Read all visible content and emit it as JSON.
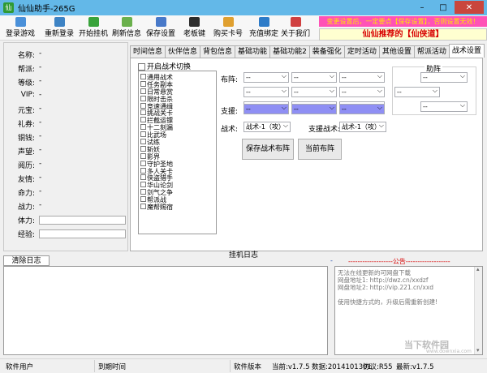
{
  "window": {
    "title": "仙仙助手-265G",
    "minimize": "–",
    "maximize": "□",
    "close": "✕"
  },
  "toolbar": {
    "login": "登录游戏",
    "relogin": "重新登录",
    "start": "开始挂机",
    "refresh": "刷新信息",
    "save": "保存设置",
    "boss": "老板键",
    "buycard": "购买卡号",
    "bind": "充值绑定",
    "about": "关于我们"
  },
  "notice": {
    "warning": "变更设置后，一定要点【保存设置】，否则设置无效！",
    "recommend": "仙仙推荐的【仙侠道】"
  },
  "stats": [
    {
      "label": "名称:",
      "value": "-"
    },
    {
      "label": "帮派:",
      "value": "-"
    },
    {
      "label": "等级:",
      "value": "-"
    },
    {
      "label": "VIP:",
      "value": "-"
    },
    {
      "label": "元宝:",
      "value": "-"
    },
    {
      "label": "礼券:",
      "value": "-"
    },
    {
      "label": "铜钱:",
      "value": "-"
    },
    {
      "label": "声望:",
      "value": "-"
    },
    {
      "label": "阅历:",
      "value": "-"
    },
    {
      "label": "友情:",
      "value": "-"
    },
    {
      "label": "命力:",
      "value": "-"
    },
    {
      "label": "战力:",
      "value": "-"
    }
  ],
  "bars": {
    "stamina_label": "体力:",
    "exp_label": "经验:"
  },
  "tabs": [
    "时间信息",
    "伙伴信息",
    "背包信息",
    "基础功能",
    "基础功能2",
    "装备强化",
    "定时活动",
    "其他设置",
    "帮派活动",
    "战术设置"
  ],
  "tactics": {
    "switch_label": "开启战术切换",
    "skills": [
      "通用战术",
      "任务副本",
      "日常悬赏",
      "限时击杀",
      "竞速通缉",
      "挑战关卡",
      "拦截运镖",
      "十二刻漏",
      "比武场",
      "试练",
      "斩妖",
      "影界",
      "守护圣地",
      "多人关卡",
      "侠盗猎手",
      "华山论剑",
      "剑气之争",
      "帮派战",
      "魔帮赐宿"
    ],
    "formation_label": "布阵:",
    "assist_label": "助阵",
    "support_label": "支援:",
    "tactic_label": "战术:",
    "support_tactic_label": "支援战术:",
    "placeholder": "--",
    "tactic_value": "战术-1（攻）",
    "save_formation": "保存战术布阵",
    "current_formation": "当前布阵"
  },
  "log": {
    "title": "挂机日志",
    "clear": "清除日志",
    "tab_marker": "-",
    "announcement_header": "-------------------公告-------------------",
    "announcement_lines": [
      "无法在线更新的可网盘下载",
      "网盘地址1: http://dwz.cn/xxdzf",
      "网盘地址2: http://vip.221.cn/xxd",
      "",
      "使用快捷方式的，升级后需重新创建!"
    ]
  },
  "watermark": {
    "name": "当下软件园",
    "url": "www.downxia.com"
  },
  "status": {
    "user": "软件用户",
    "expire": "到期时间",
    "version_label": "软件版本",
    "current": "当前:v1.7.5",
    "data": "数据:2014101301",
    "protocol": "协议:R55",
    "latest": "最新:v1.7.5"
  },
  "colors": {
    "titlebar": "#63b8e8",
    "notice_bg": "#ff52b6",
    "notice_text": "#ffe600",
    "recommend_text": "#d80000",
    "support_select": "#8f8ff4"
  }
}
